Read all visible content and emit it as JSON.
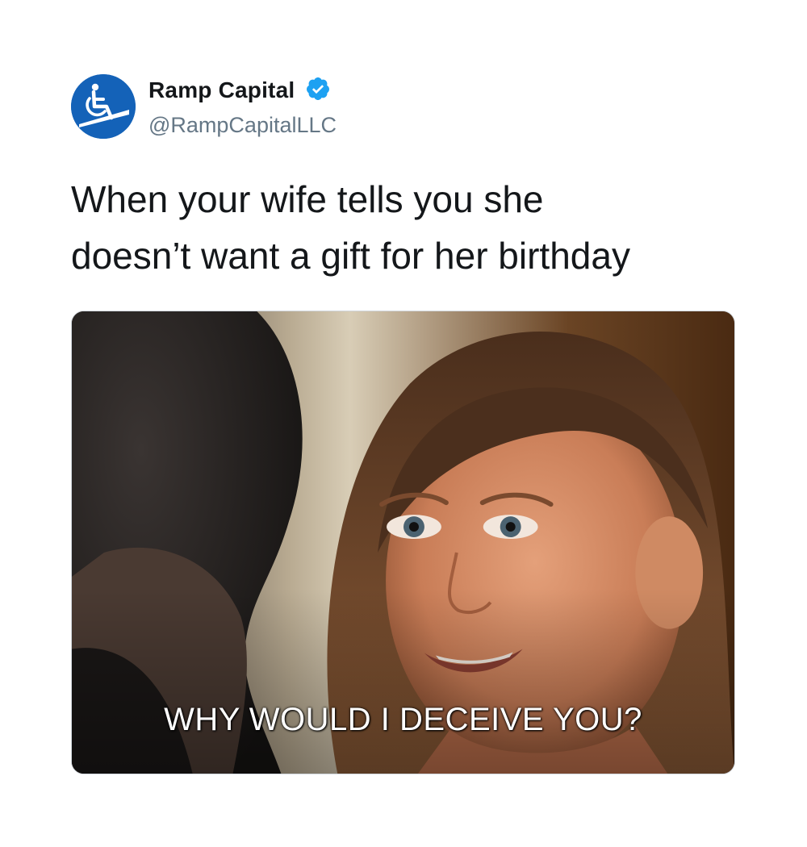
{
  "tweet": {
    "author": {
      "display_name": "Ramp Capital",
      "handle": "@RampCapitalLLC",
      "avatar_icon": "wheelchair-ramp-icon",
      "verified_icon": "verified-badge-icon",
      "avatar_color": "#1462b8",
      "verified_color": "#1da1f2"
    },
    "text_line1": "When your wife tells you she",
    "text_line2": "doesn’t want a gift for her birthday",
    "media": {
      "caption": "WHY WOULD I DECEIVE YOU?"
    }
  }
}
